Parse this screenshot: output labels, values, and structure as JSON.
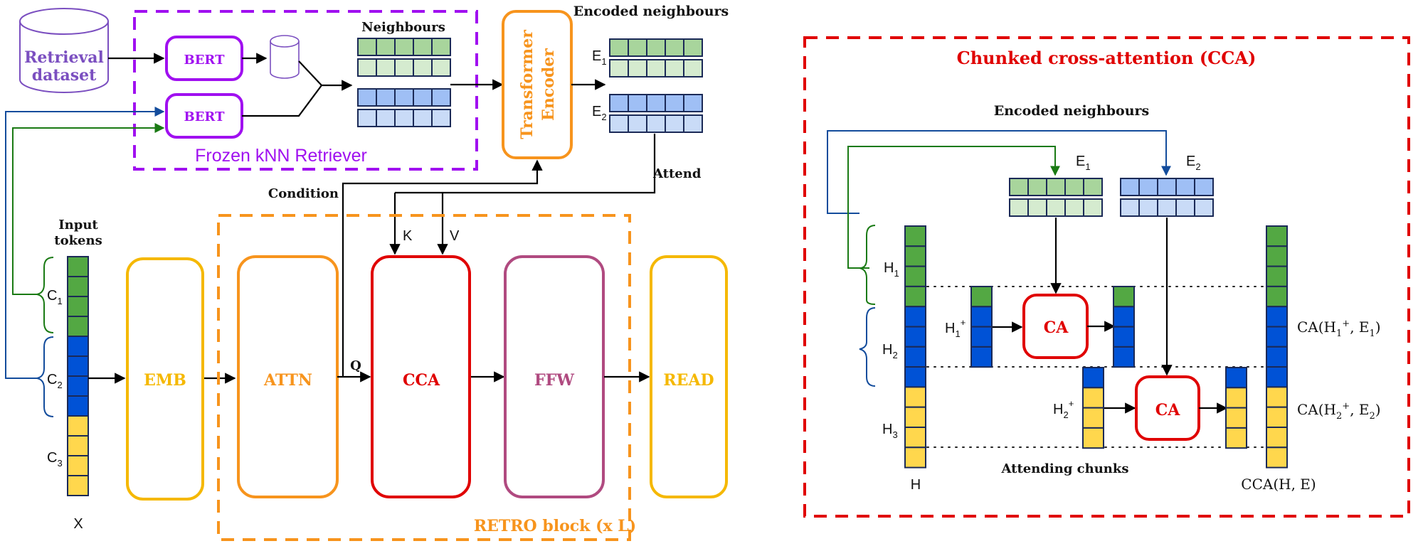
{
  "colors": {
    "purple": "#a010f0",
    "dataset": "#7b4fc0",
    "orange": "#f7941d",
    "yellow": "#f5b800",
    "red": "#e00000",
    "magenta": "#b04a80",
    "green_link": "#1a7a14",
    "blue_link": "#134c9c",
    "token_green": "#53a843",
    "token_blue": "#0052d6",
    "token_yellow": "#ffd74d",
    "neighbour_green_dark": "#a8d59c",
    "neighbour_green_light": "#d5ebcf",
    "neighbour_blue_dark": "#9fbff5",
    "neighbour_blue_light": "#c9dbf7",
    "cell_border": "#1b2a57"
  },
  "left": {
    "retrieval_dataset": [
      "Retrieval",
      "dataset"
    ],
    "bert_top": "BERT",
    "bert_bottom": "BERT",
    "neighbours_label": "Neighbours",
    "retriever_label": "Frozen kNN Retriever",
    "transformer_encoder": [
      "Transformer",
      "Encoder"
    ],
    "encoded_neighbours_label": "Encoded neighbours",
    "e1": {
      "base": "E",
      "sub": "1"
    },
    "e2": {
      "base": "E",
      "sub": "2"
    },
    "attend_label": "Attend",
    "condition_label": "Condition",
    "input_tokens_label": [
      "Input",
      "tokens"
    ],
    "chunks": [
      {
        "base": "C",
        "sub": "1",
        "color": "green"
      },
      {
        "base": "C",
        "sub": "2",
        "color": "blue"
      },
      {
        "base": "C",
        "sub": "3",
        "color": "yellow"
      }
    ],
    "x_label": "X",
    "blocks": {
      "emb": "EMB",
      "attn": "ATTN",
      "cca": "CCA",
      "ffw": "FFW",
      "read": "READ"
    },
    "q_label": "Q",
    "k_label": "K",
    "v_label": "V",
    "retro_block_label": "RETRO block (x L)"
  },
  "right": {
    "title": "Chunked cross-attention (CCA)",
    "encoded_neighbours_label": "Encoded neighbours",
    "e1": {
      "base": "E",
      "sub": "1"
    },
    "e2": {
      "base": "E",
      "sub": "2"
    },
    "h_chunks": [
      {
        "base": "H",
        "sub": "1"
      },
      {
        "base": "H",
        "sub": "2"
      },
      {
        "base": "H",
        "sub": "3"
      }
    ],
    "h1_plus": {
      "base": "H",
      "sub": "1",
      "sup": "+"
    },
    "h2_plus": {
      "base": "H",
      "sub": "2",
      "sup": "+"
    },
    "ca_label": "CA",
    "ca_out_1": {
      "prefix": "CA(H",
      "sub1": "1",
      "sup": "+",
      "mid": ", E",
      "sub2": "1",
      "suffix": ")"
    },
    "ca_out_2": {
      "prefix": "CA(H",
      "sub1": "2",
      "sup": "+",
      "mid": ", E",
      "sub2": "2",
      "suffix": ")"
    },
    "h_label": "H",
    "attending_chunks_label": "Attending chunks",
    "cca_output_label": "CCA(H, E)"
  }
}
